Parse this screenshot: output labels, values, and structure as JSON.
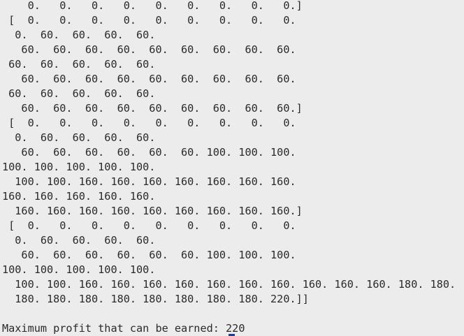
{
  "terminal": {
    "lines": [
      "    0.   0.   0.   0.   0.   0.   0.   0.   0.]",
      " [  0.   0.   0.   0.   0.   0.   0.   0.   0.",
      "  0.  60.  60.  60.  60.",
      "   60.  60.  60.  60.  60.  60.  60.  60.  60.",
      " 60.  60.  60.  60.  60.",
      "   60.  60.  60.  60.  60.  60.  60.  60.  60.",
      " 60.  60.  60.  60.  60.",
      "   60.  60.  60.  60.  60.  60.  60.  60.  60.]",
      " [  0.   0.   0.   0.   0.   0.   0.   0.   0.",
      "  0.  60.  60.  60.  60.",
      "   60.  60.  60.  60.  60.  60. 100. 100. 100.",
      "100. 100. 100. 100. 100.",
      "  100. 100. 160. 160. 160. 160. 160. 160. 160.",
      "160. 160. 160. 160. 160.",
      "  160. 160. 160. 160. 160. 160. 160. 160. 160.]",
      " [  0.   0.   0.   0.   0.   0.   0.   0.   0.",
      "  0.  60.  60.  60.  60.",
      "   60.  60.  60.  60.  60.  60. 100. 100. 100.",
      "100. 100. 100. 100. 100.",
      "  100. 100. 160. 160. 160. 160. 160. 160. 160. 160. 160. 160. 180. 180.",
      "  180. 180. 180. 180. 180. 180. 180. 180. 220.]]",
      "",
      "Maximum profit that can be earned: 220"
    ]
  }
}
